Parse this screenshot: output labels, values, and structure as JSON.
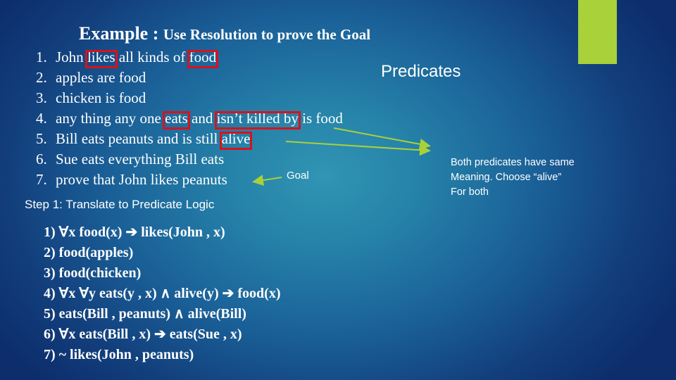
{
  "colors": {
    "accent_bar": "#a8d13a",
    "highlight_box": "#d9121b",
    "arrow": "#a8d13a",
    "text": "#ffffff"
  },
  "title": {
    "main": "Example : ",
    "sub": "Use Resolution to prove the Goal"
  },
  "statements": [
    {
      "num": "1.",
      "parts": [
        "John ",
        "likes",
        " all kinds of ",
        "food"
      ],
      "highlighted": [
        1,
        3
      ]
    },
    {
      "num": "2.",
      "parts": [
        "apples are food"
      ],
      "highlighted": []
    },
    {
      "num": "3.",
      "parts": [
        "chicken is food"
      ],
      "highlighted": []
    },
    {
      "num": "4.",
      "parts": [
        "any thing any one ",
        "eats",
        " and ",
        "isn’t killed by",
        " is food"
      ],
      "highlighted": [
        1,
        3
      ]
    },
    {
      "num": "5.",
      "parts": [
        "Bill eats peanuts and is still ",
        "alive "
      ],
      "highlighted": [
        1
      ]
    },
    {
      "num": "6.",
      "parts": [
        "Sue eats everything Bill eats"
      ],
      "highlighted": []
    },
    {
      "num": "7.",
      "parts": [
        "prove that John likes peanuts"
      ],
      "highlighted": []
    }
  ],
  "predicates_label": "Predicates",
  "goal_label": "Goal",
  "note": {
    "line1": "Both predicates have same",
    "line2": "Meaning.  Choose “alive”",
    "line3": "For both"
  },
  "step_label": "Step 1: Translate to Predicate Logic",
  "logic": [
    "1) ∀x food(x) ➔ likes(John , x)",
    "2) food(apples)",
    "3) food(chicken)",
    "4) ∀x ∀y eats(y , x) ∧ alive(y) ➔ food(x)",
    "5) eats(Bill , peanuts) ∧ alive(Bill)",
    "6) ∀x eats(Bill , x) ➔ eats(Sue , x)",
    "7) ~ likes(John , peanuts)"
  ]
}
